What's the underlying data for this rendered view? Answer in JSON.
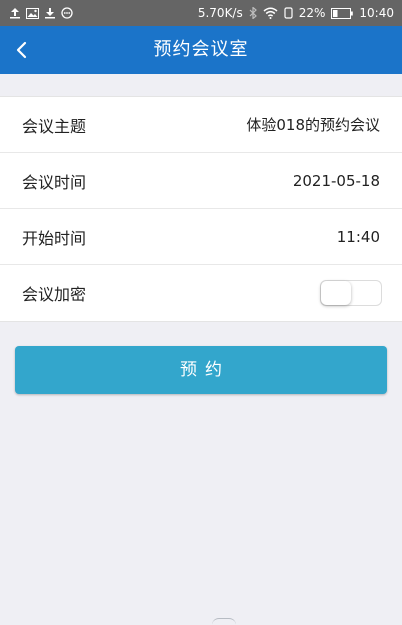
{
  "status_bar": {
    "network_speed": "5.70K/s",
    "battery_percent": "22%",
    "time": "10:40",
    "icons": [
      "upload-icon",
      "image-icon",
      "download-icon",
      "chat-icon",
      "bluetooth-icon",
      "wifi-icon",
      "vibrate-icon",
      "battery-icon"
    ]
  },
  "header": {
    "back_icon": "chevron-left-icon",
    "title": "预约会议室",
    "color": "#1b74c9"
  },
  "form": {
    "rows": [
      {
        "label": "会议主题",
        "value": "体验018的预约会议"
      },
      {
        "label": "会议时间",
        "value": "2021-05-18"
      },
      {
        "label": "开始时间",
        "value": "11:40"
      },
      {
        "label": "会议加密",
        "toggle_on": false
      }
    ]
  },
  "actions": {
    "reserve_label": "预约",
    "reserve_color": "#33a6cc"
  }
}
